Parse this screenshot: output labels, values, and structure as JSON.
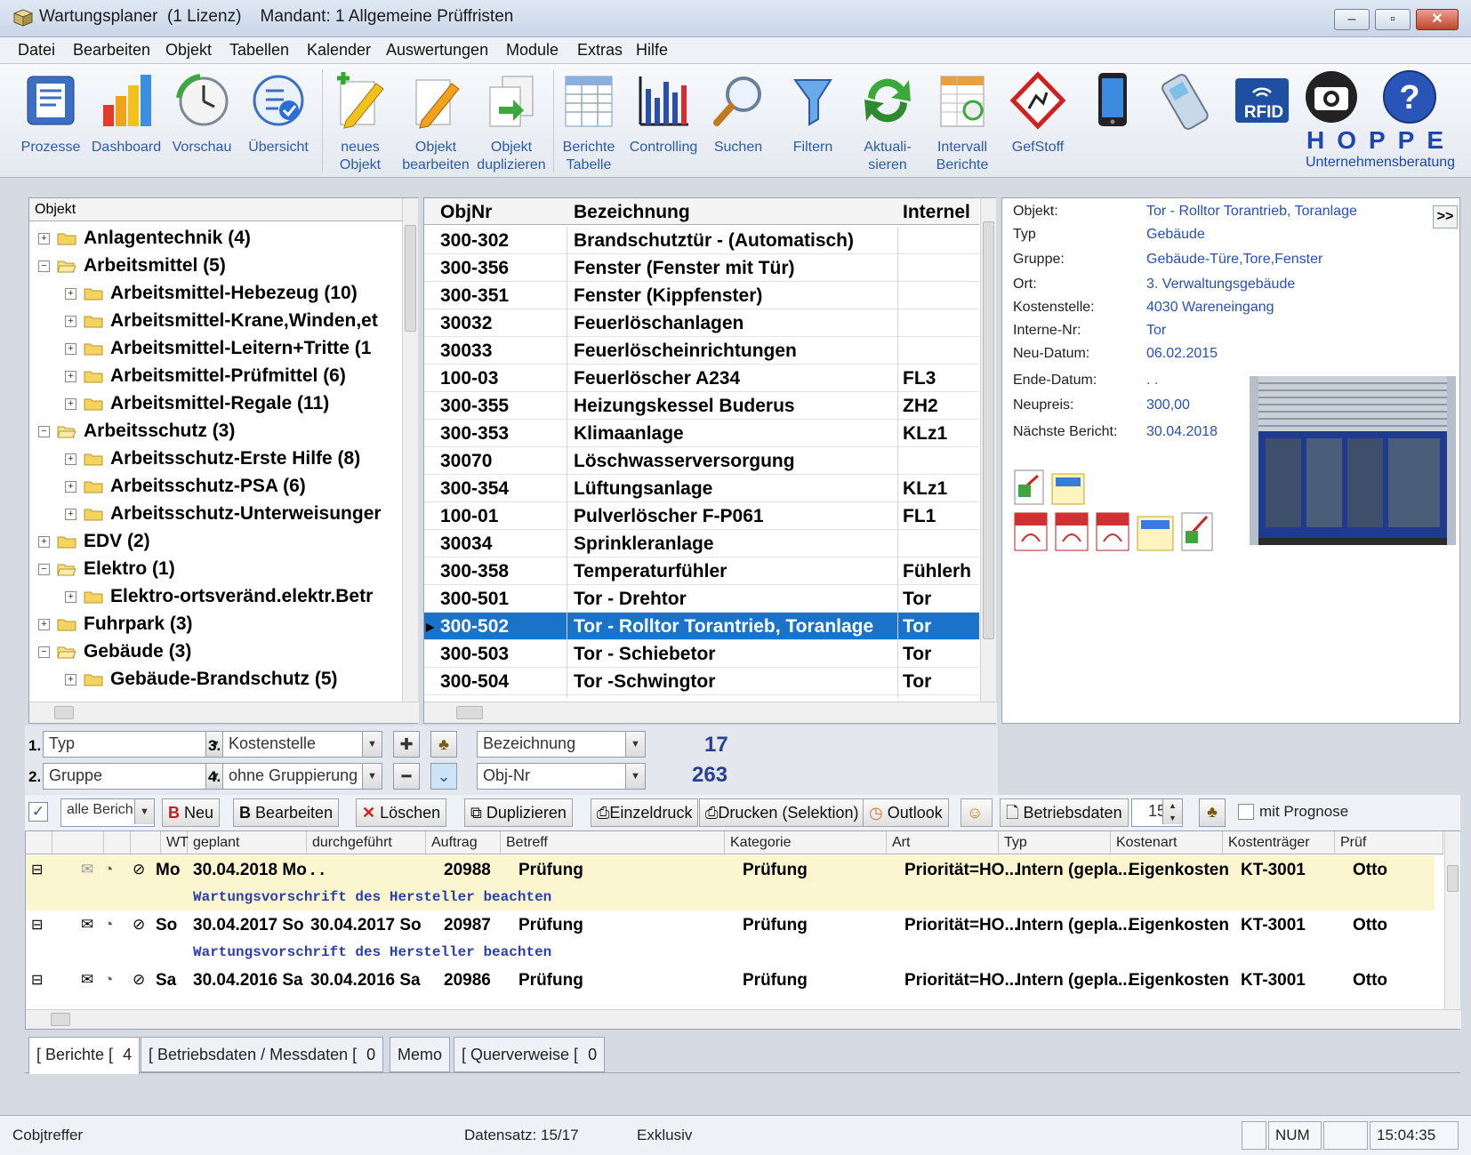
{
  "window": {
    "title": "Wartungsplaner  (1 Lizenz)    Mandant: 1 Allgemeine Prüffristen"
  },
  "menu": [
    "Datei",
    "Bearbeiten",
    "Objekt",
    "Tabellen",
    "Kalender",
    "Auswertungen",
    "Module",
    "Extras",
    "Hilfe"
  ],
  "toolbar": {
    "prozesse": "Prozesse",
    "dashboard": "Dashboard",
    "vorschau": "Vorschau",
    "uebersicht": "Übersicht",
    "neues_objekt": "neues\nObjekt",
    "objekt_bearbeiten": "Objekt\nbearbeiten",
    "objekt_duplizieren": "Objekt\nduplizieren",
    "berichte_tabelle": "Berichte\nTabelle",
    "controlling": "Controlling",
    "suchen": "Suchen",
    "filtern": "Filtern",
    "aktualisieren": "Aktuali-\nsieren",
    "intervall_berichte": "Intervall\nBerichte",
    "gefstoff": "GefStoff",
    "rfid": "RFID",
    "brand": "HOPPE",
    "brand_sub": "Unternehmensberatung"
  },
  "tree": {
    "header": "Objekt",
    "items": [
      {
        "label": "Anlagentechnik  (4)",
        "level": 0,
        "open": false
      },
      {
        "label": "Arbeitsmittel  (5)",
        "level": 0,
        "open": true
      },
      {
        "label": "Arbeitsmittel-Hebezeug  (10)",
        "level": 1,
        "open": false
      },
      {
        "label": "Arbeitsmittel-Krane,Winden,et",
        "level": 1,
        "open": false
      },
      {
        "label": "Arbeitsmittel-Leitern+Tritte  (1",
        "level": 1,
        "open": false
      },
      {
        "label": "Arbeitsmittel-Prüfmittel  (6)",
        "level": 1,
        "open": false
      },
      {
        "label": "Arbeitsmittel-Regale  (11)",
        "level": 1,
        "open": false
      },
      {
        "label": "Arbeitsschutz  (3)",
        "level": 0,
        "open": true
      },
      {
        "label": "Arbeitsschutz-Erste Hilfe  (8)",
        "level": 1,
        "open": false
      },
      {
        "label": "Arbeitsschutz-PSA  (6)",
        "level": 1,
        "open": false
      },
      {
        "label": "Arbeitsschutz-Unterweisunger",
        "level": 1,
        "open": false
      },
      {
        "label": "EDV  (2)",
        "level": 0,
        "open": false
      },
      {
        "label": "Elektro  (1)",
        "level": 0,
        "open": true
      },
      {
        "label": "Elektro-ortsveränd.elektr.Betr",
        "level": 1,
        "open": false
      },
      {
        "label": "Fuhrpark  (3)",
        "level": 0,
        "open": false
      },
      {
        "label": "Gebäude  (3)",
        "level": 0,
        "open": true
      },
      {
        "label": "Gebäude-Brandschutz  (5)",
        "level": 1,
        "open": false
      }
    ]
  },
  "grid": {
    "headers": [
      "ObjNr",
      "Bezeichnung",
      "Internel"
    ],
    "rows": [
      [
        "300-302",
        "Brandschutztür - (Automatisch)",
        ""
      ],
      [
        "300-356",
        "Fenster  (Fenster mit Tür)",
        ""
      ],
      [
        "300-351",
        "Fenster  (Kippfenster)",
        ""
      ],
      [
        "30032",
        "Feuerlöschanlagen",
        ""
      ],
      [
        "30033",
        "Feuerlöscheinrichtungen",
        ""
      ],
      [
        "100-03",
        "Feuerlöscher A234",
        "FL3"
      ],
      [
        "300-355",
        "Heizungskessel Buderus",
        "ZH2"
      ],
      [
        "300-353",
        "Klimaanlage",
        "KLz1"
      ],
      [
        "30070",
        "Löschwasserversorgung",
        ""
      ],
      [
        "300-354",
        "Lüftungsanlage",
        "KLz1"
      ],
      [
        "100-01",
        "Pulverlöscher F-P061",
        "FL1"
      ],
      [
        "30034",
        "Sprinkleranlage",
        ""
      ],
      [
        "300-358",
        "Temperaturfühler",
        "Fühlerh"
      ],
      [
        "300-501",
        "Tor - Drehtor",
        "Tor"
      ],
      [
        "300-502",
        "Tor - Rolltor  Torantrieb, Toranlage",
        "Tor"
      ],
      [
        "300-503",
        "Tor - Schiebetor",
        "Tor"
      ],
      [
        "300-504",
        "Tor -Schwingtor",
        "Tor"
      ]
    ],
    "selected_index": 14
  },
  "details": {
    "expand_label": ">>",
    "fields": [
      {
        "label": "Objekt:",
        "value": "Tor - Rolltor  Torantrieb, Toranlage"
      },
      {
        "label": "Typ",
        "value": "Gebäude"
      },
      {
        "label": "Gruppe:",
        "value": "Gebäude-Türe,Tore,Fenster"
      },
      {
        "label": "Ort:",
        "value": "3. Verwaltungsgebäude"
      },
      {
        "label": "Kostenstelle:",
        "value": "4030 Wareneingang"
      },
      {
        "label": "Interne-Nr:",
        "value": "Tor"
      },
      {
        "label": "Neu-Datum:",
        "value": "06.02.2015"
      },
      {
        "label": "Ende-Datum:",
        "value": ". ."
      },
      {
        "label": "Neupreis:",
        "value": "300,00"
      },
      {
        "label": "Nächste Bericht:",
        "value": "30.04.2018"
      }
    ]
  },
  "filters": {
    "num1": "1.",
    "f1": "Typ",
    "num2": "2.",
    "f2": "Gruppe",
    "num3": "3.",
    "f3": "Kostenstelle",
    "num4": "4.",
    "f4": "ohne Gruppierung",
    "sort1": "Bezeichnung",
    "sort2": "Obj-Nr",
    "count_visible": "17",
    "count_total": "263"
  },
  "report_toolbar": {
    "all_reports": "alle Berich",
    "neu": "Neu",
    "bearbeiten": "Bearbeiten",
    "loeschen": "Löschen",
    "duplizieren": "Duplizieren",
    "einzeldruck": "Einzeldruck",
    "drucken_selektion": "Drucken (Selektion)",
    "outlook": "Outlook",
    "betriebsdaten": "Betriebsdaten",
    "spin_value": "15",
    "mit_prognose": "mit Prognose"
  },
  "reports": {
    "headers": [
      "WT",
      "geplant",
      "durchgeführt",
      "Auftrag",
      "Betreff",
      "Kategorie",
      "Art",
      "Typ",
      "Kostenart",
      "Kostenträger",
      "Prüf"
    ],
    "rows": [
      {
        "wt": "Mo",
        "geplant": "30.04.2018 Mo",
        "durchgefuehrt": ". .",
        "auftrag": "20988",
        "betreff": "Prüfung",
        "kategorie": "Prüfung",
        "art": "Priorität=HO...",
        "typ": "Intern (gepla...",
        "kostenart": "Eigenkosten",
        "kostentraeger": "KT-3001",
        "pruef": "Otto",
        "note": "Wartungsvorschrift des Hersteller beachten"
      },
      {
        "wt": "So",
        "geplant": "30.04.2017 So",
        "durchgefuehrt": "30.04.2017 So",
        "auftrag": "20987",
        "betreff": "Prüfung",
        "kategorie": "Prüfung",
        "art": "Priorität=HO...",
        "typ": "Intern (gepla...",
        "kostenart": "Eigenkosten",
        "kostentraeger": "KT-3001",
        "pruef": "Otto",
        "note": "Wartungsvorschrift des Hersteller beachten"
      },
      {
        "wt": "Sa",
        "geplant": "30.04.2016 Sa",
        "durchgefuehrt": "30.04.2016 Sa",
        "auftrag": "20986",
        "betreff": "Prüfung",
        "kategorie": "Prüfung",
        "art": "Priorität=HO...",
        "typ": "Intern (gepla...",
        "kostenart": "Eigenkosten",
        "kostentraeger": "KT-3001",
        "pruef": "Otto",
        "note": ""
      }
    ]
  },
  "tabs": [
    {
      "label": "[ Berichte [",
      "count": "4"
    },
    {
      "label": "[ Betriebsdaten / Messdaten [",
      "count": "0"
    },
    {
      "label": "Memo",
      "count": ""
    },
    {
      "label": "[ Querverweise [",
      "count": "0"
    }
  ],
  "status": {
    "left": "Cobjtreffer",
    "datensatz": "Datensatz: 15/17",
    "mode": "Exklusiv",
    "num": "NUM",
    "time": "15:04:35"
  },
  "colors": {
    "selection": "#1b73c9",
    "link_blue": "#2650b5",
    "report_highlight": "#fbf6cf"
  }
}
